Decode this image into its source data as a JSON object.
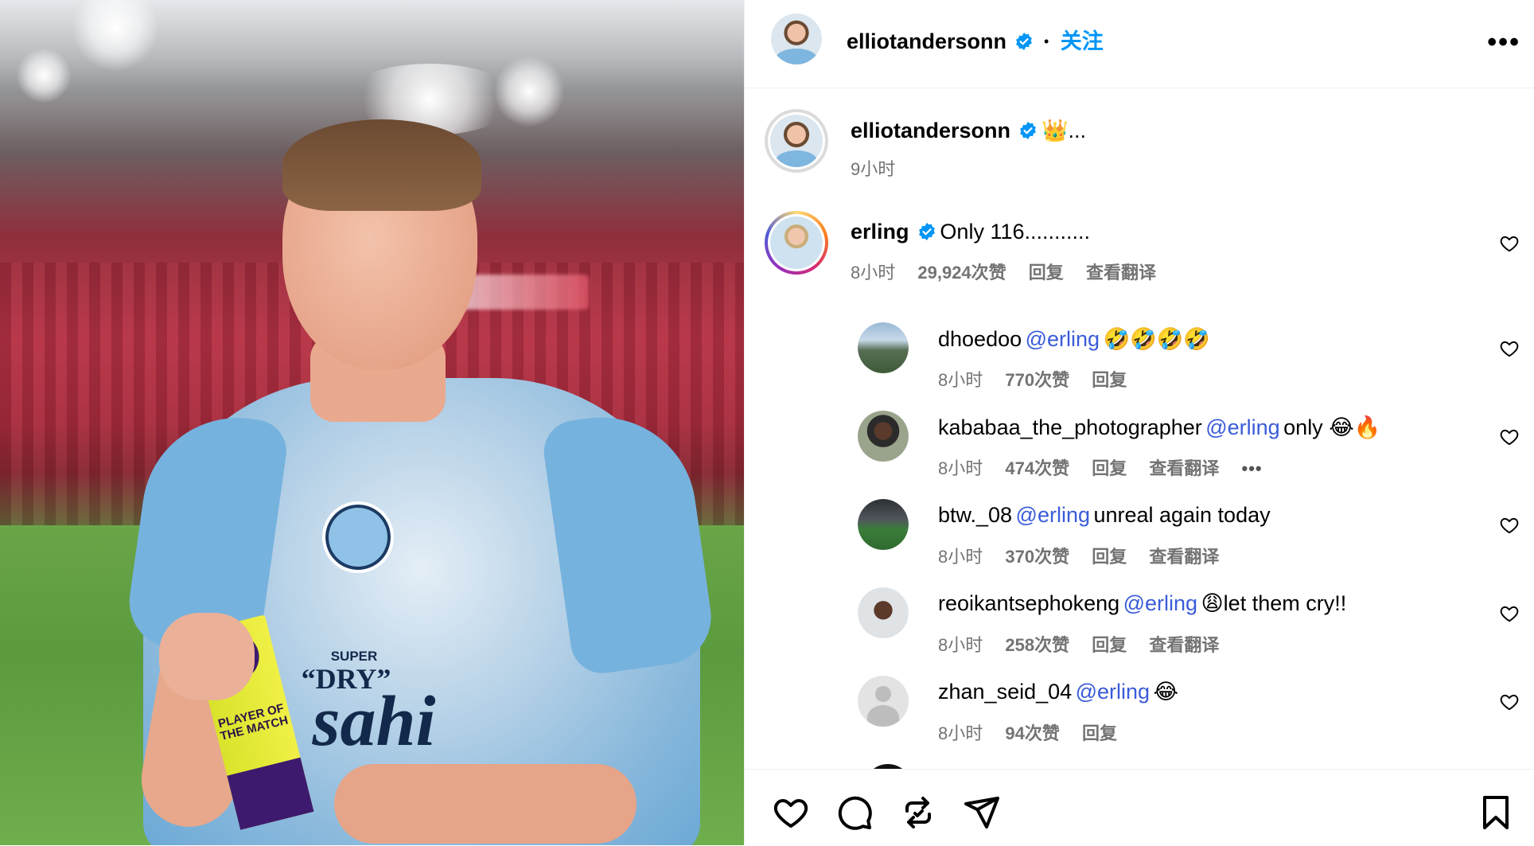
{
  "post": {
    "author": "elliotandersonn",
    "follow_label": "关注",
    "separator": "•",
    "more_label": "•••"
  },
  "caption": {
    "username": "elliotandersonn",
    "text": "👑...",
    "time": "9小时"
  },
  "comments": [
    {
      "username": "erling",
      "verified": true,
      "mention": "",
      "text": "Only 116...........",
      "time": "8小时",
      "likes": "29,924次赞",
      "reply": "回复",
      "translate": "查看翻译"
    }
  ],
  "replies": [
    {
      "username": "dhoedoo",
      "mention": "@erling",
      "text": "🤣🤣🤣🤣",
      "time": "8小时",
      "likes": "770次赞",
      "reply": "回复",
      "translate": "",
      "more": ""
    },
    {
      "username": "kababaa_the_photographer",
      "mention": "@erling",
      "text": "only 😂🔥",
      "time": "8小时",
      "likes": "474次赞",
      "reply": "回复",
      "translate": "查看翻译",
      "more": "•••"
    },
    {
      "username": "btw._08",
      "mention": "@erling",
      "text": "unreal again today",
      "time": "8小时",
      "likes": "370次赞",
      "reply": "回复",
      "translate": "查看翻译",
      "more": ""
    },
    {
      "username": "reoikantsephokeng",
      "mention": "@erling",
      "text": "😩let them cry!!",
      "time": "8小时",
      "likes": "258次赞",
      "reply": "回复",
      "translate": "查看翻译",
      "more": ""
    },
    {
      "username": "zhan_seid_04",
      "mention": "@erling",
      "text": "😂",
      "time": "8小时",
      "likes": "94次赞",
      "reply": "回复",
      "translate": "",
      "more": ""
    }
  ],
  "photo": {
    "shirt_sponsor_1": "SUPER",
    "shirt_sponsor_2": "“DRY”",
    "shirt_sponsor_3": "sahi",
    "trophy_text": "PLAYER OF THE MATCH"
  },
  "colors": {
    "verified": "#0095f6",
    "follow": "#0095f6",
    "mention": "#3a5bd9",
    "meta": "#737373"
  },
  "icons": {
    "like": "heart-icon",
    "comment": "comment-icon",
    "repost": "repost-icon",
    "share": "send-icon",
    "save": "bookmark-icon"
  }
}
